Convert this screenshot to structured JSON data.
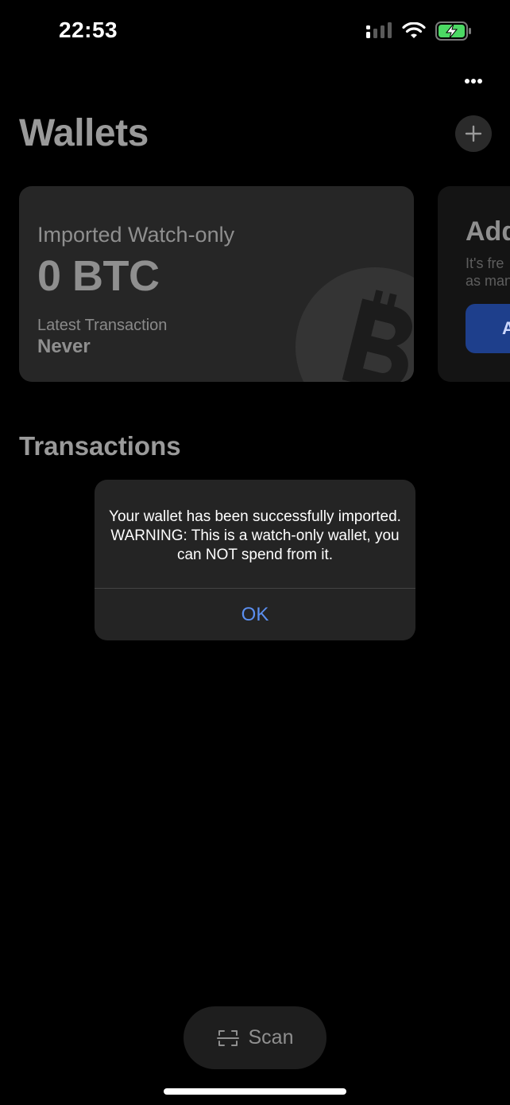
{
  "status_bar": {
    "time": "22:53",
    "signal": "signal-icon",
    "wifi": "wifi-icon",
    "battery": "battery-charging-icon"
  },
  "header": {
    "title": "Wallets",
    "more_icon": "more-horizontal-icon",
    "add_icon": "plus-icon"
  },
  "wallet_card": {
    "type": "Imported Watch-only",
    "balance": "0 BTC",
    "latest_label": "Latest Transaction",
    "latest_value": "Never",
    "bg_icon": "bitcoin-icon"
  },
  "add_card": {
    "title": "Add",
    "desc_line1": "It's fre",
    "desc_line2": "as man",
    "button_label": "A"
  },
  "transactions": {
    "title": "Transactions"
  },
  "alert": {
    "message": "Your wallet has been successfully imported. WARNING: This is a watch-only wallet, you can NOT spend from it.",
    "ok_label": "OK"
  },
  "scan": {
    "label": "Scan",
    "icon": "scan-icon"
  },
  "colors": {
    "background": "#000000",
    "card": "#262626",
    "accent": "#5b8ff0",
    "battery": "#4cd964"
  }
}
